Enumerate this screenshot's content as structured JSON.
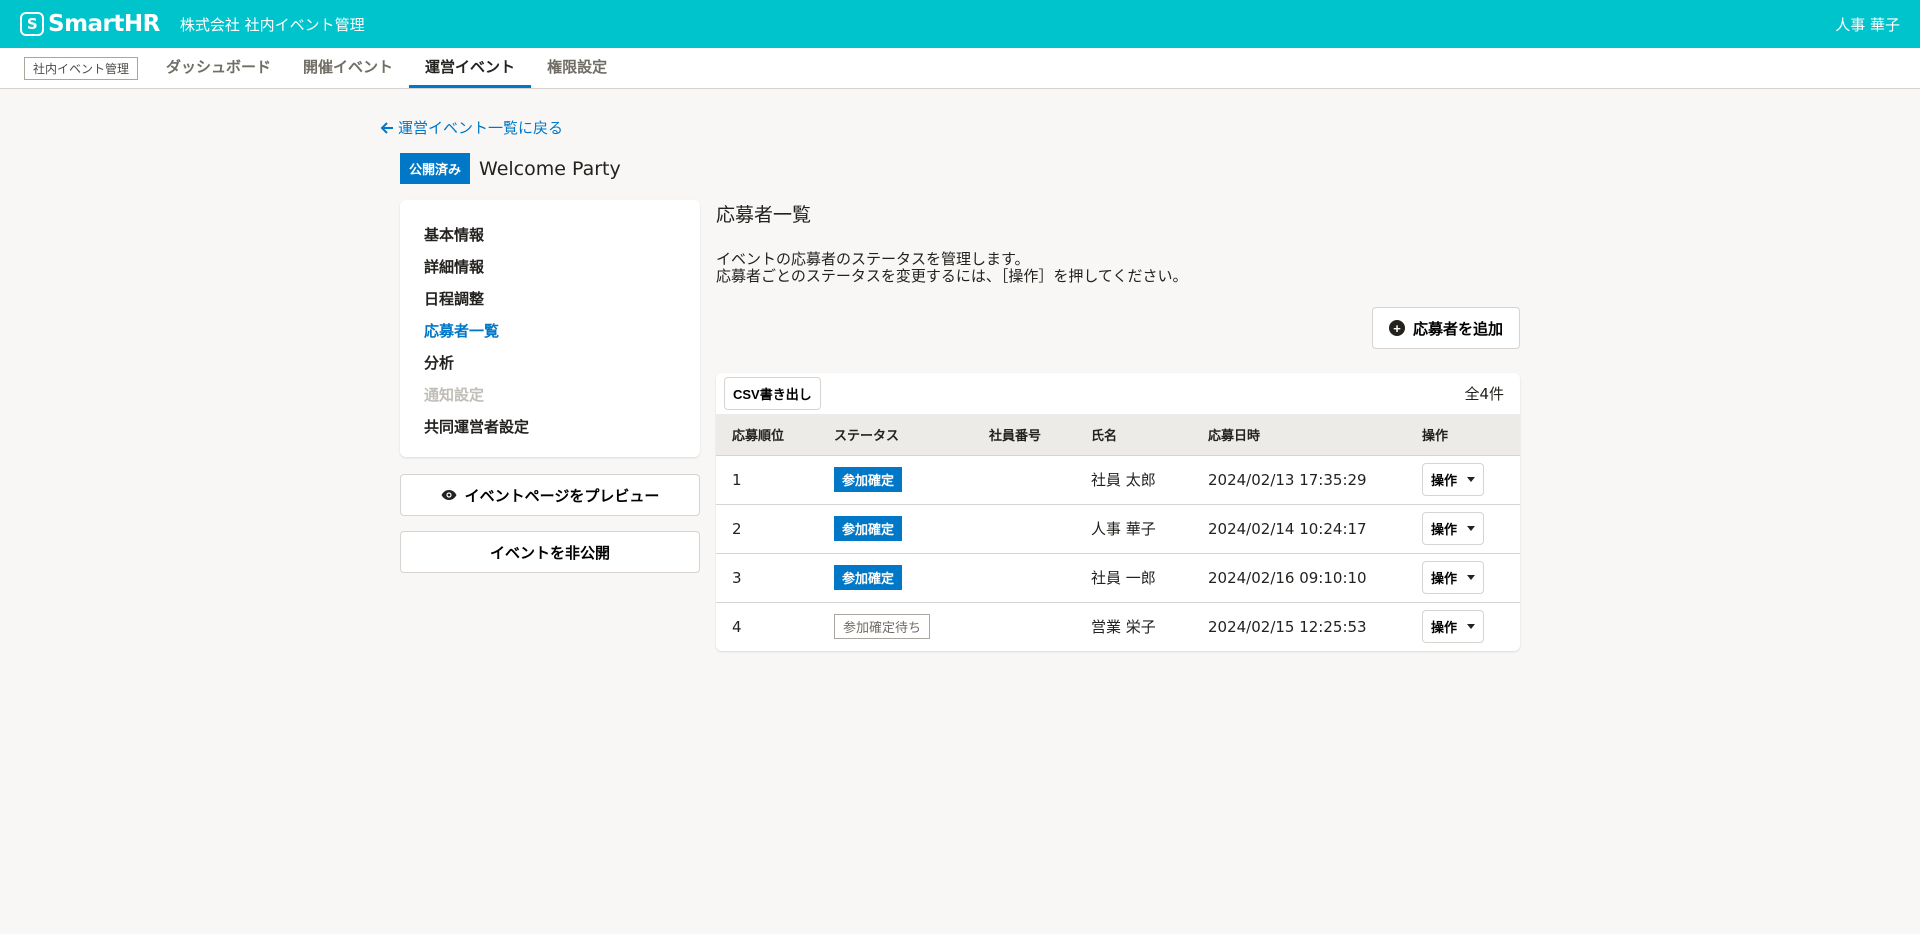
{
  "header": {
    "logo_text": "SmartHR",
    "company": "株式会社 社内イベント管理",
    "user": "人事 華子"
  },
  "appnav": {
    "app_badge": "社内イベント管理",
    "items": [
      {
        "label": "ダッシュボード"
      },
      {
        "label": "開催イベント"
      },
      {
        "label": "運営イベント"
      },
      {
        "label": "権限設定"
      }
    ]
  },
  "page": {
    "back_link": "運営イベント一覧に戻る",
    "status_badge": "公開済み",
    "event_title": "Welcome Party"
  },
  "sidebar": {
    "items": [
      {
        "label": "基本情報"
      },
      {
        "label": "詳細情報"
      },
      {
        "label": "日程調整"
      },
      {
        "label": "応募者一覧"
      },
      {
        "label": "分析"
      },
      {
        "label": "通知設定"
      },
      {
        "label": "共同運営者設定"
      }
    ],
    "preview_button": "イベントページをプレビュー",
    "unpublish_button": "イベントを非公開"
  },
  "main": {
    "title": "応募者一覧",
    "desc_line1": "イベントの応募者のステータスを管理します。",
    "desc_line2": "応募者ごとのステータスを変更するには、［操作］を押してください。",
    "add_button": "応募者を追加",
    "csv_button": "CSV書き出し",
    "total": "全4件",
    "columns": [
      "応募順位",
      "ステータス",
      "社員番号",
      "氏名",
      "応募日時",
      "操作"
    ],
    "rows": [
      {
        "rank": "1",
        "status": "参加確定",
        "emp_no": "",
        "name": "社員 太郎",
        "date": "2024/02/13 17:35:29",
        "op": "操作"
      },
      {
        "rank": "2",
        "status": "参加確定",
        "emp_no": "",
        "name": "人事 華子",
        "date": "2024/02/14 10:24:17",
        "op": "操作"
      },
      {
        "rank": "3",
        "status": "参加確定",
        "emp_no": "",
        "name": "社員 一郎",
        "date": "2024/02/16 09:10:10",
        "op": "操作"
      },
      {
        "rank": "4",
        "status": "参加確定待ち",
        "emp_no": "",
        "name": "営業 栄子",
        "date": "2024/02/15 12:25:53",
        "op": "操作"
      }
    ]
  },
  "colors": {
    "header_bg": "#00c4cc",
    "accent": "#0077c7",
    "page_bg": "#f8f7f6"
  }
}
